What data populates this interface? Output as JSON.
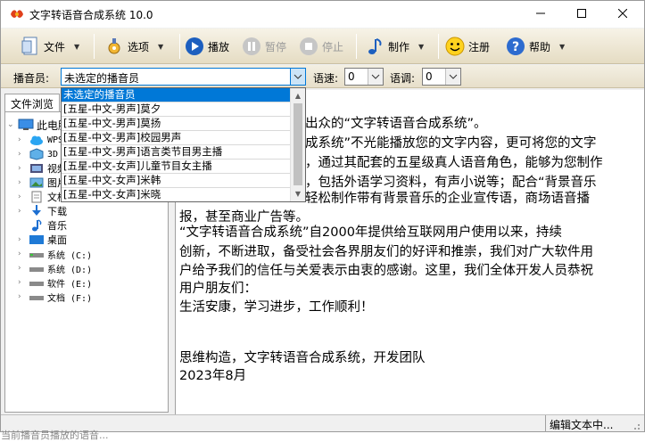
{
  "window": {
    "title": "文字转语音合成系统 10.0",
    "minimize_icon": "minimize-icon",
    "maximize_icon": "maximize-icon",
    "close_icon": "close-icon"
  },
  "toolbar": {
    "file_label": "文件",
    "options_label": "选项",
    "play_label": "播放",
    "pause_label": "暂停",
    "stop_label": "停止",
    "make_label": "制作",
    "register_label": "注册",
    "help_label": "帮助"
  },
  "announcer_row": {
    "announcer_label": "播音员:",
    "announcer_value": "未选定的播音员",
    "speed_label": "语速:",
    "speed_value": "0",
    "pitch_label": "语调:",
    "pitch_value": "0"
  },
  "announcer_options": [
    "未选定的播音员",
    "[五星-中文-男声]莫夕",
    "[五星-中文-男声]莫扬",
    "[五星-中文-男声]校园男声",
    "[五星-中文-男声]语言类节目男主播",
    "[五星-中文-女声]儿童节目女主播",
    "[五星-中文-女声]米韩",
    "[五星-中文-女声]米晓"
  ],
  "file_browser": {
    "tab_label": "文件浏览",
    "nodes": [
      {
        "label": "此电脑",
        "icon": "computer-icon"
      },
      {
        "label": "WPS",
        "icon": "cloud-icon"
      },
      {
        "label": "3D",
        "icon": "cube-icon"
      },
      {
        "label": "视频",
        "icon": "video-icon"
      },
      {
        "label": "图片",
        "icon": "picture-icon"
      },
      {
        "label": "文档",
        "icon": "document-icon"
      },
      {
        "label": "下载",
        "icon": "download-icon"
      },
      {
        "label": "音乐",
        "icon": "music-icon"
      },
      {
        "label": "桌面",
        "icon": "desktop-icon"
      },
      {
        "label": "系统 (C:)",
        "icon": "drive-icon"
      },
      {
        "label": "系统 (D:)",
        "icon": "drive-icon"
      },
      {
        "label": "软件 (E:)",
        "icon": "drive-icon"
      },
      {
        "label": "文档 (F:)",
        "icon": "drive-icon"
      }
    ]
  },
  "editor": {
    "lines": [
      "出众的“文字转语音合成系统”。",
      "成系统”不光能播放您的文字内容，更可将您的文字",
      "，通过其配套的五星级真人语音角色，能够为您制作",
      "，包括外语学习资料，有声小说等；配合“背景音乐",
      "轻松制作带有背景音乐的企业宣传语，商场语音播",
      "报，甚至商业广告等。",
      "    “文字转语音合成系统”自2000年提供给互联网用户使用以来，持续",
      "创新，不断进取，备受社会各界朋友们的好评和推崇，我们对广大软件用",
      "户给予我们的信任与关爱表示由衷的感谢。这里，我们全体开发人员恭祝",
      "用户朋友们：",
      "    生活安康，学习进步，工作顺利！",
      "",
      "",
      "思维构造，文字转语音合成系统，开发团队",
      "2023年8月"
    ]
  },
  "status": {
    "editing_text": "编辑文本中...",
    "partial_text": "当前播音员播放的语音..."
  }
}
